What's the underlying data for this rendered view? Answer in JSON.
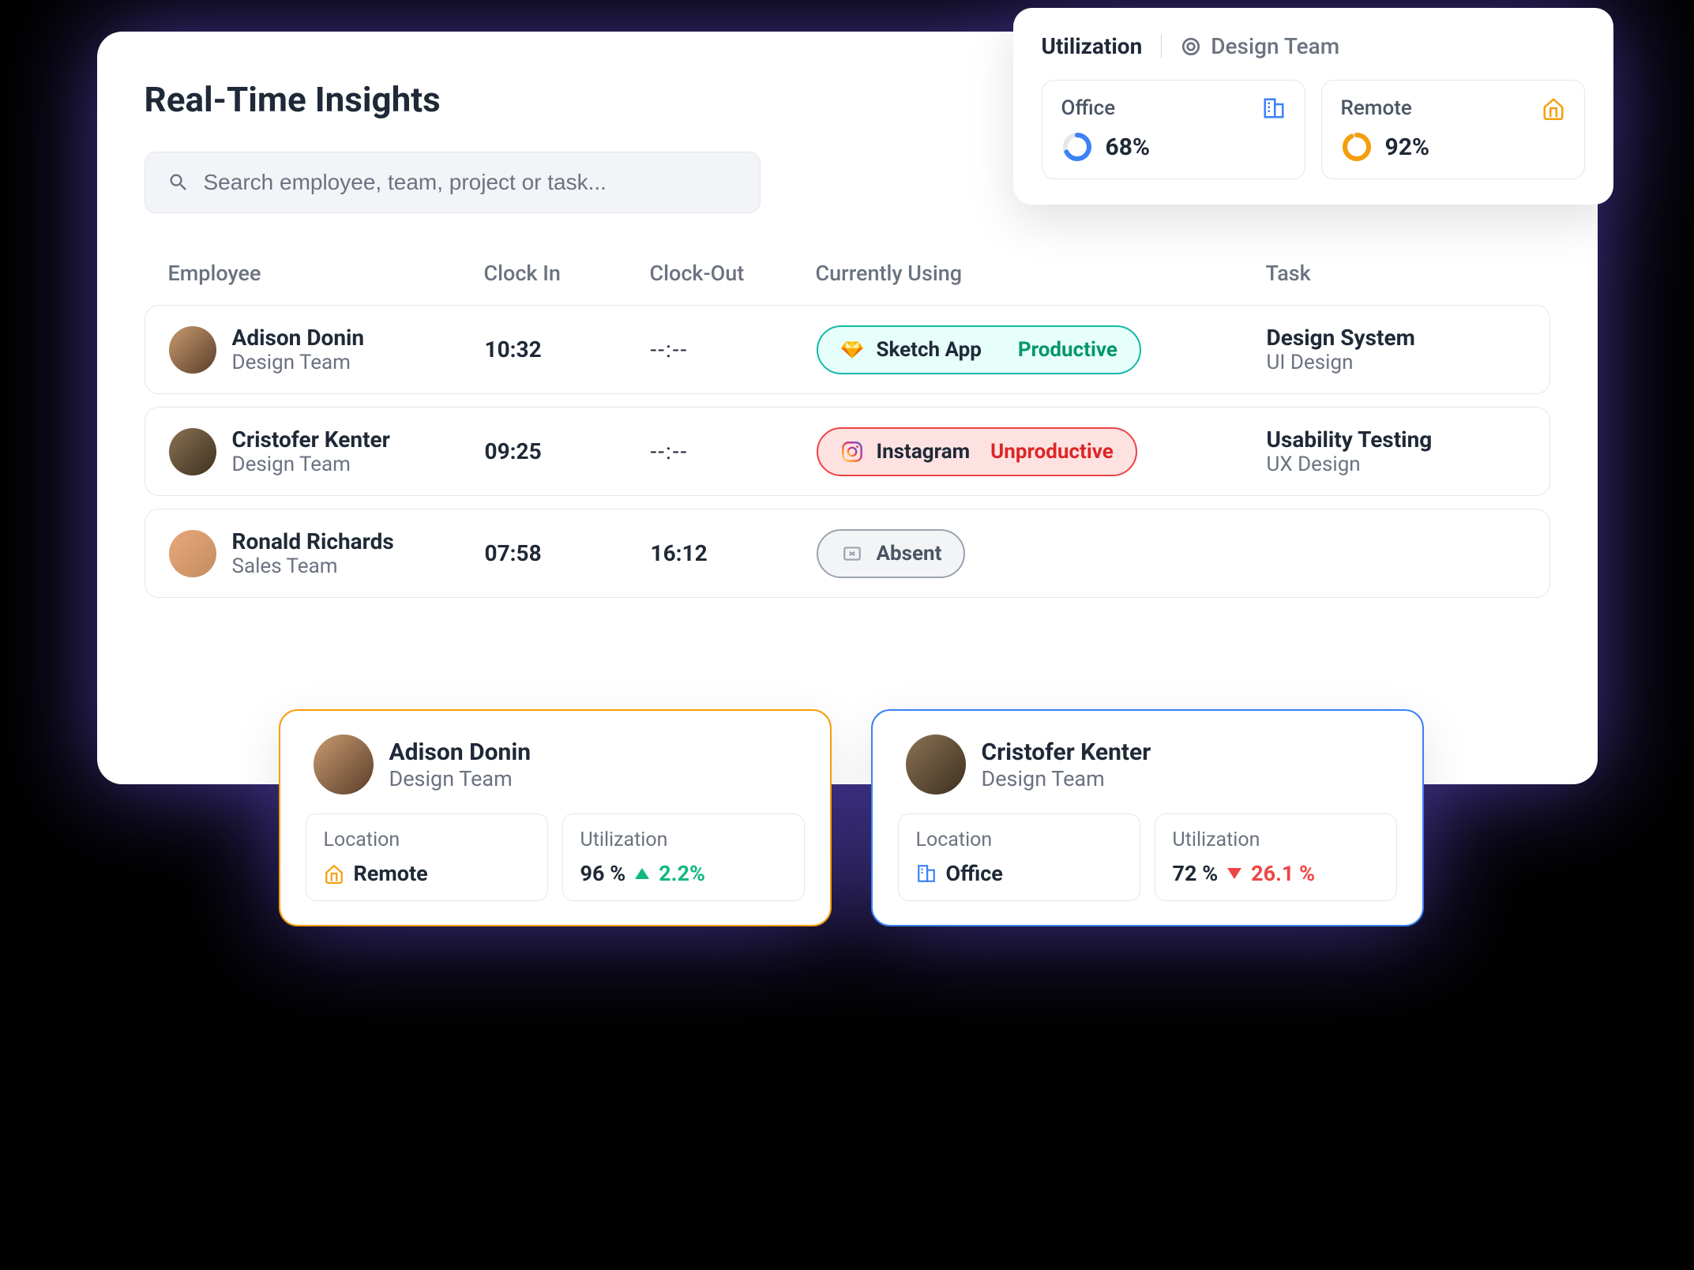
{
  "page_title": "Real-Time Insights",
  "search_placeholder": "Search employee, team, project or task...",
  "headers": {
    "employee": "Employee",
    "clock_in": "Clock In",
    "clock_out": "Clock-Out",
    "currently_using": "Currently Using",
    "task": "Task"
  },
  "rows": [
    {
      "name": "Adison Donin",
      "team": "Design Team",
      "clock_in": "10:32",
      "clock_out": "--:--",
      "app": "Sketch App",
      "status": "Productive",
      "task": "Design System",
      "task_sub": "UI Design"
    },
    {
      "name": "Cristofer Kenter",
      "team": "Design Team",
      "clock_in": "09:25",
      "clock_out": "--:--",
      "app": "Instagram",
      "status": "Unproductive",
      "task": "Usability Testing",
      "task_sub": "UX Design"
    },
    {
      "name": "Ronald Richards",
      "team": "Sales Team",
      "clock_in": "07:58",
      "clock_out": "16:12",
      "app": "Absent",
      "status": "",
      "task": "",
      "task_sub": ""
    }
  ],
  "utilization": {
    "title": "Utilization",
    "team": "Design Team",
    "office": {
      "label": "Office",
      "value": "68%"
    },
    "remote": {
      "label": "Remote",
      "value": "92%"
    }
  },
  "profiles": [
    {
      "name": "Adison Donin",
      "team": "Design Team",
      "location_label": "Location",
      "location": "Remote",
      "utilization_label": "Utilization",
      "utilization": "96 %",
      "delta": "2.2%",
      "delta_dir": "up"
    },
    {
      "name": "Cristofer Kenter",
      "team": "Design Team",
      "location_label": "Location",
      "location": "Office",
      "utilization_label": "Utilization",
      "utilization": "72 %",
      "delta": "26.1 %",
      "delta_dir": "down"
    }
  ]
}
